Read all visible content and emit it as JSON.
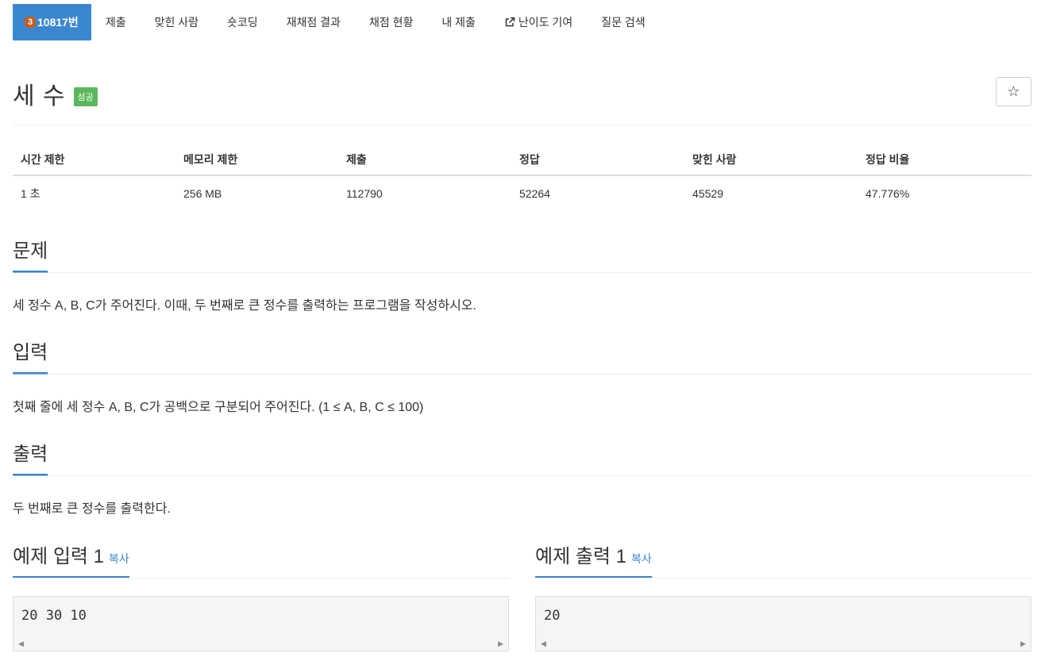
{
  "nav": {
    "tier_badge": "3",
    "problem_number": "10817번",
    "items": [
      "제출",
      "맞힌 사람",
      "숏코딩",
      "재채점 결과",
      "채점 현황",
      "내 제출",
      "난이도 기여",
      "질문 검색"
    ]
  },
  "title": "세 수",
  "status_badge": "성공",
  "star_icon_glyph": "☆",
  "info": {
    "headers": [
      "시간 제한",
      "메모리 제한",
      "제출",
      "정답",
      "맞힌 사람",
      "정답 비율"
    ],
    "values": [
      "1 초",
      "256 MB",
      "112790",
      "52264",
      "45529",
      "47.776%"
    ]
  },
  "sections": {
    "problem_title": "문제",
    "problem_text": "세 정수 A, B, C가 주어진다. 이때, 두 번째로 큰 정수를 출력하는 프로그램을 작성하시오.",
    "input_title": "입력",
    "input_text": "첫째 줄에 세 정수 A, B, C가 공백으로 구분되어 주어진다. (1 ≤ A, B, C ≤ 100)",
    "output_title": "출력",
    "output_text": "두 번째로 큰 정수를 출력한다."
  },
  "samples": {
    "input_title": "예제 입력 1",
    "output_title": "예제 출력 1",
    "copy_label": "복사",
    "input_value": "20 30 10",
    "output_value": "20"
  },
  "colors": {
    "accent": "#3a87d0",
    "success": "#5cb85c",
    "tier": "#c75d1a"
  }
}
